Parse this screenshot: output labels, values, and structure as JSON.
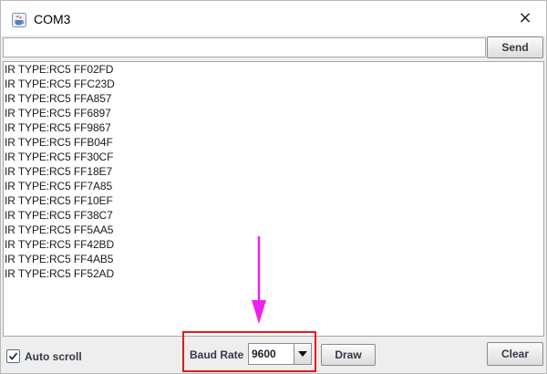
{
  "window": {
    "title": "COM3",
    "close_symbol": "×"
  },
  "send_bar": {
    "input_value": "",
    "send_label": "Send"
  },
  "output": {
    "lines": [
      "IR TYPE:RC5 FF02FD",
      "IR TYPE:RC5 FFC23D",
      "IR TYPE:RC5 FFA857",
      "IR TYPE:RC5 FF6897",
      "IR TYPE:RC5 FF9867",
      "IR TYPE:RC5 FFB04F",
      "IR TYPE:RC5 FF30CF",
      "IR TYPE:RC5 FF18E7",
      "IR TYPE:RC5 FF7A85",
      "IR TYPE:RC5 FF10EF",
      "IR TYPE:RC5 FF38C7",
      "IR TYPE:RC5 FF5AA5",
      "IR TYPE:RC5 FF42BD",
      "IR TYPE:RC5 FF4AB5",
      "IR TYPE:RC5 FF52AD"
    ]
  },
  "bottom_bar": {
    "autoscroll_label": "Auto scroll",
    "autoscroll_checked": true,
    "baud_label": "Baud Rate",
    "baud_value": "9600",
    "draw_label": "Draw",
    "clear_label": "Clear"
  },
  "icons": {
    "app": "java-app-icon",
    "close": "close-icon",
    "dropdown": "triangle-down-icon",
    "check": "checkmark-icon",
    "annotation": "arrow-down-icon"
  },
  "colors": {
    "highlight_box": "#e21b1b",
    "annotation_arrow": "#ee22ee"
  }
}
